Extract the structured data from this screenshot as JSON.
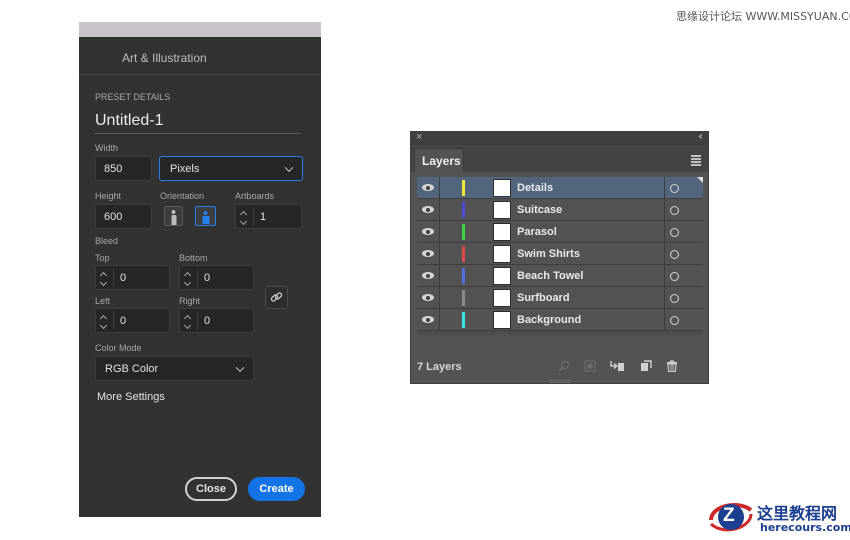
{
  "watermark": "思缘设计论坛 WWW.MISSYUAN.COM",
  "dialog": {
    "title": "Art & Illustration",
    "preset_details_label": "PRESET DETAILS",
    "doc_name": "Untitled-1",
    "width_label": "Width",
    "width_value": "850",
    "units_value": "Pixels",
    "height_label": "Height",
    "height_value": "600",
    "orientation_label": "Orientation",
    "artboards_label": "Artboards",
    "artboards_value": "1",
    "bleed_label": "Bleed",
    "top_label": "Top",
    "top_value": "0",
    "bottom_label": "Bottom",
    "bottom_value": "0",
    "left_label": "Left",
    "left_value": "0",
    "right_label": "Right",
    "right_value": "0",
    "color_mode_label": "Color Mode",
    "color_mode_value": "RGB Color",
    "more_settings": "More Settings",
    "close_label": "Close",
    "create_label": "Create",
    "colors": {
      "background": "#323232",
      "accent": "#1473e6"
    }
  },
  "layers_panel": {
    "tab_label": "Layers",
    "close_glyph": "×",
    "collapse_glyph": "‹‹",
    "layer_count": "7 Layers",
    "layers": [
      {
        "name": "Details",
        "color": "#f2e637",
        "selected": true
      },
      {
        "name": "Suitcase",
        "color": "#4b4bd8",
        "selected": false
      },
      {
        "name": "Parasol",
        "color": "#3ed83e",
        "selected": false
      },
      {
        "name": "Swim Shirts",
        "color": "#e04848",
        "selected": false
      },
      {
        "name": "Beach Towel",
        "color": "#4f6fe0",
        "selected": false
      },
      {
        "name": "Surfboard",
        "color": "#8a8a8a",
        "selected": false
      },
      {
        "name": "Background",
        "color": "#3ee0e8",
        "selected": false
      }
    ],
    "footer_icons": [
      "locate-object-icon",
      "make-clipping-mask-icon",
      "create-sublayer-icon",
      "new-layer-icon",
      "delete-icon"
    ]
  },
  "logo": {
    "cn_text": "这里教程网",
    "en_text": "herecours.com",
    "letter": "Z"
  }
}
